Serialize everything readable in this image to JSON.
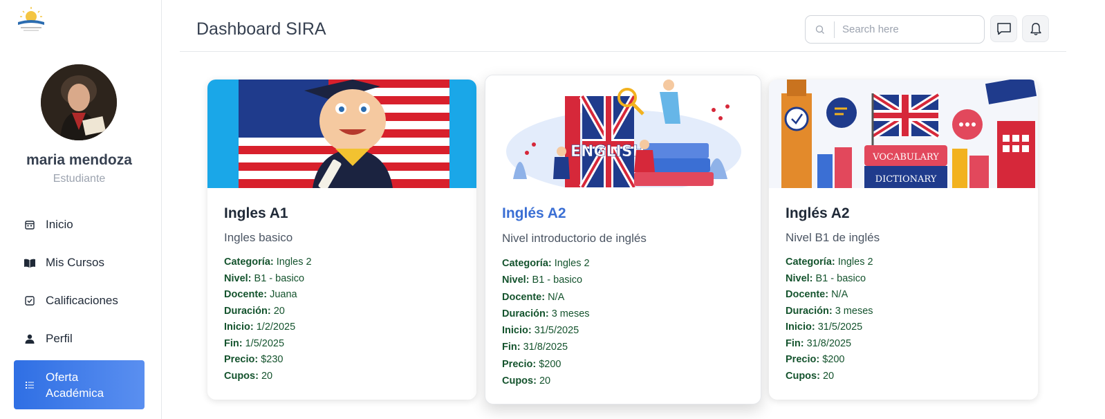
{
  "app": {
    "page_title": "Dashboard SIRA"
  },
  "user": {
    "name": "maria mendoza",
    "role": "Estudiante"
  },
  "nav": [
    {
      "label": "Inicio",
      "icon": "calendar-icon"
    },
    {
      "label": "Mis Cursos",
      "icon": "book-icon"
    },
    {
      "label": "Calificaciones",
      "icon": "checkbox-icon"
    },
    {
      "label": "Perfil",
      "icon": "person-icon"
    },
    {
      "label": "Oferta\nAcadémica",
      "icon": "list-icon",
      "active": true
    }
  ],
  "search": {
    "placeholder": "Search here"
  },
  "courses": [
    {
      "title": "Ingles A1",
      "subtitle": "Ingles basico",
      "details": [
        {
          "label": "Categoría:",
          "value": "Ingles 2"
        },
        {
          "label": "Nivel:",
          "value": "B1 - basico"
        },
        {
          "label": "Docente:",
          "value": "Juana"
        },
        {
          "label": "Duración:",
          "value": "20"
        },
        {
          "label": "Inicio:",
          "value": "1/2/2025"
        },
        {
          "label": "Fin:",
          "value": "1/5/2025"
        },
        {
          "label": "Precio:",
          "value": "$230"
        },
        {
          "label": "Cupos:",
          "value": "20"
        }
      ]
    },
    {
      "title": "Inglés A2",
      "subtitle": "Nivel introductorio de inglés",
      "image_text": "ENGLISH",
      "details": [
        {
          "label": "Categoría:",
          "value": "Ingles 2"
        },
        {
          "label": "Nivel:",
          "value": "B1 - basico"
        },
        {
          "label": "Docente:",
          "value": "N/A"
        },
        {
          "label": "Duración:",
          "value": "3 meses"
        },
        {
          "label": "Inicio:",
          "value": "31/5/2025"
        },
        {
          "label": "Fin:",
          "value": "31/8/2025"
        },
        {
          "label": "Precio:",
          "value": "$200"
        },
        {
          "label": "Cupos:",
          "value": "20"
        }
      ]
    },
    {
      "title": "Inglés A2",
      "subtitle": "Nivel B1 de inglés",
      "image_text": [
        "VOCABULARY",
        "DICTIONARY"
      ],
      "details": [
        {
          "label": "Categoría:",
          "value": "Ingles 2"
        },
        {
          "label": "Nivel:",
          "value": "B1 - basico"
        },
        {
          "label": "Docente:",
          "value": "N/A"
        },
        {
          "label": "Duración:",
          "value": "3 meses"
        },
        {
          "label": "Inicio:",
          "value": "31/5/2025"
        },
        {
          "label": "Fin:",
          "value": "31/8/2025"
        },
        {
          "label": "Precio:",
          "value": "$200"
        },
        {
          "label": "Cupos:",
          "value": "20"
        }
      ]
    }
  ],
  "colors": {
    "accent": "#2f6fe4",
    "highlight_title": "#3b6fd4",
    "detail_text": "#14532d"
  }
}
